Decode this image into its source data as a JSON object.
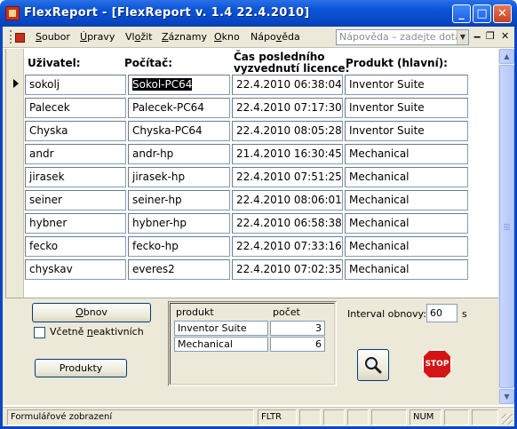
{
  "window": {
    "title": "FlexReport - [FlexReport v. 1.4 22.4.2010]",
    "minimize_glyph": "_",
    "maximize_glyph": "□",
    "close_glyph": "✕"
  },
  "menu": {
    "items": [
      {
        "pre": "",
        "u": "S",
        "post": "oubor"
      },
      {
        "pre": "",
        "u": "Ú",
        "post": "pravy"
      },
      {
        "pre": "Vl",
        "u": "o",
        "post": "žit"
      },
      {
        "pre": "",
        "u": "Z",
        "post": "áznamy"
      },
      {
        "pre": "",
        "u": "O",
        "post": "kno"
      },
      {
        "pre": "Nápo",
        "u": "v",
        "post": "ěda"
      }
    ],
    "help_placeholder": "Nápověda – zadejte dotaz",
    "mdi_minimize": "‒",
    "mdi_restore": "❐",
    "mdi_close": "✕"
  },
  "table": {
    "headers": {
      "user": "Uživatel:",
      "computer": "Počítač:",
      "time_line1": "Čas posledního",
      "time_line2": "vyzvednutí licence:",
      "product": "Produkt (hlavní):"
    },
    "rows": [
      {
        "user": "sokolj",
        "computer": "Sokol-PC64",
        "time": "22.4.2010 06:38:04",
        "product": "Inventor Suite"
      },
      {
        "user": "Palecek",
        "computer": "Palecek-PC64",
        "time": "22.4.2010 07:17:30",
        "product": "Inventor Suite"
      },
      {
        "user": "Chyska",
        "computer": "Chyska-PC64",
        "time": "22.4.2010 08:05:28",
        "product": "Inventor Suite"
      },
      {
        "user": "andr",
        "computer": "andr-hp",
        "time": "21.4.2010 16:30:45",
        "product": "Mechanical"
      },
      {
        "user": "jirasek",
        "computer": "jirasek-hp",
        "time": "22.4.2010 07:51:25",
        "product": "Mechanical"
      },
      {
        "user": "seiner",
        "computer": "seiner-hp",
        "time": "22.4.2010 08:06:01",
        "product": "Mechanical"
      },
      {
        "user": "hybner",
        "computer": "hybner-hp",
        "time": "22.4.2010 06:58:38",
        "product": "Mechanical"
      },
      {
        "user": "fecko",
        "computer": "fecko-hp",
        "time": "22.4.2010 07:33:16",
        "product": "Mechanical"
      },
      {
        "user": "chyskav",
        "computer": "everes2",
        "time": "22.4.2010 07:02:35",
        "product": "Mechanical"
      }
    ]
  },
  "footer": {
    "refresh_pre": "",
    "refresh_u": "O",
    "refresh_post": "bnov",
    "include_inactive_pre": "Včetně ",
    "include_inactive_u": "n",
    "include_inactive_post": "eaktivních",
    "products_button": "Produkty",
    "summary": {
      "col_product": "produkt",
      "col_count": "počet",
      "rows": [
        {
          "product": "Inventor Suite",
          "count": "3"
        },
        {
          "product": "Mechanical",
          "count": "6"
        }
      ]
    },
    "interval_label": "Interval obnovy:",
    "interval_value": "60",
    "interval_unit": "s",
    "stop_label": "STOP"
  },
  "statusbar": {
    "mode": "Formulářové zobrazení",
    "filter": "FLTR",
    "num": "NUM"
  }
}
